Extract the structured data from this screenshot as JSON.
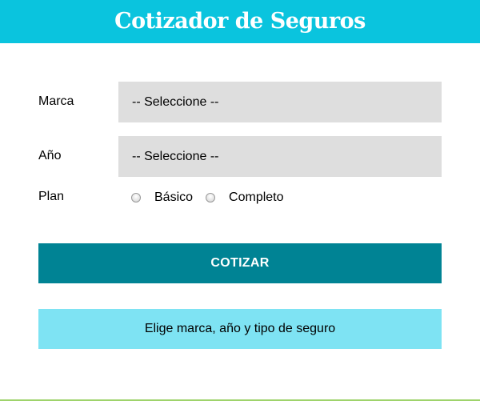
{
  "header": {
    "title": "Cotizador de Seguros"
  },
  "form": {
    "marca": {
      "label": "Marca",
      "selected": "-- Seleccione --"
    },
    "anio": {
      "label": "Año",
      "selected": "-- Seleccione --"
    },
    "plan": {
      "label": "Plan",
      "options": [
        "Básico",
        "Completo"
      ]
    },
    "submit_label": "COTIZAR"
  },
  "message": "Elige marca, año y tipo de seguro",
  "colors": {
    "header_bg": "#0ac4de",
    "button_bg": "#008394",
    "message_bg": "#7ee3f3",
    "select_bg": "#dedede",
    "footer_line": "#9ed36b"
  }
}
